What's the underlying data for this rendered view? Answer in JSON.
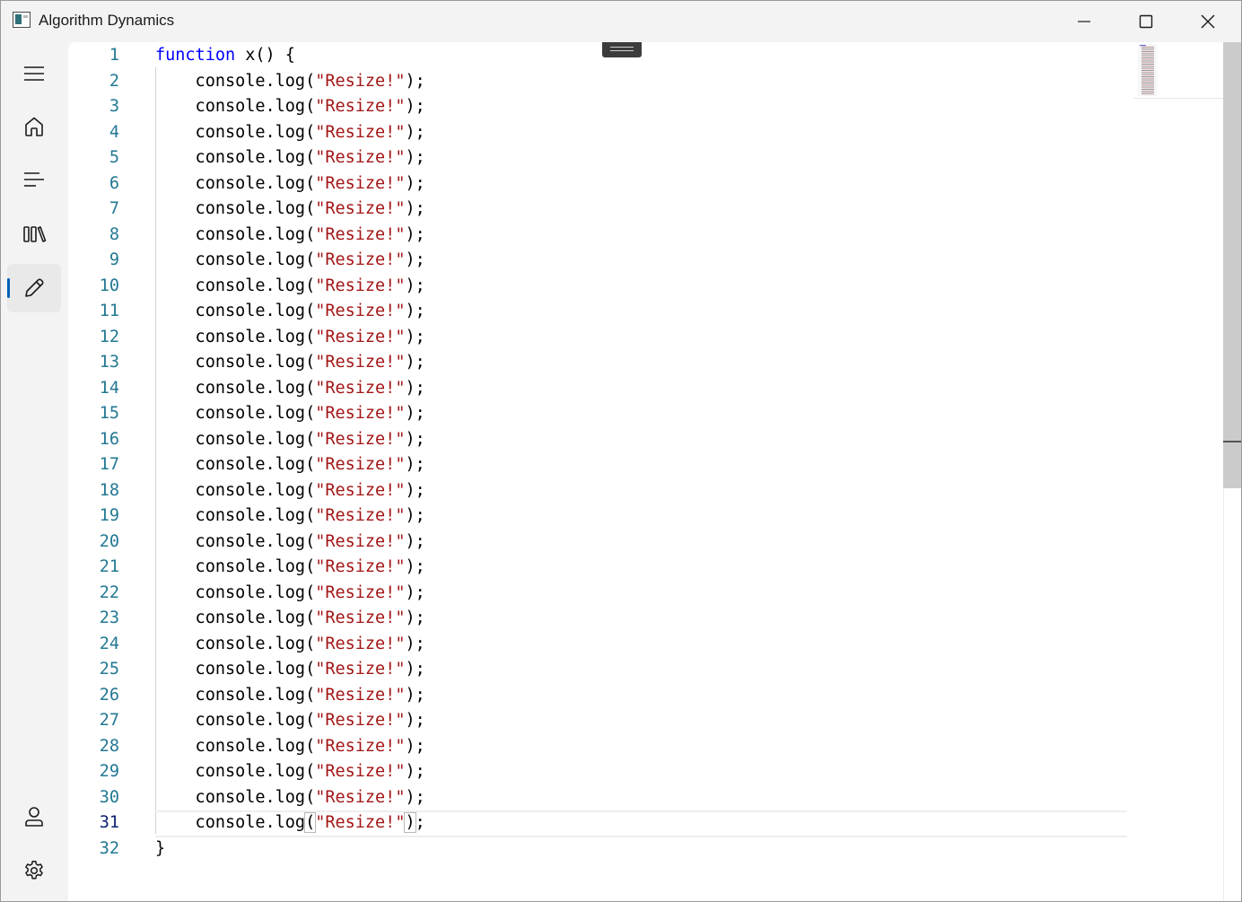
{
  "window": {
    "title": "Algorithm Dynamics"
  },
  "nav": {
    "items": [
      {
        "id": "menu",
        "icon": "hamburger-menu-icon"
      },
      {
        "id": "home",
        "icon": "home-icon"
      },
      {
        "id": "lines",
        "icon": "text-align-left-icon"
      },
      {
        "id": "library",
        "icon": "library-icon"
      },
      {
        "id": "edit",
        "icon": "pencil-icon",
        "selected": true
      },
      {
        "id": "account",
        "icon": "person-icon"
      },
      {
        "id": "settings",
        "icon": "gear-icon"
      }
    ],
    "accent": "#005fb8"
  },
  "editor": {
    "current_line": 31,
    "colors": {
      "keyword": "#0000ff",
      "string": "#a31515",
      "line_number": "#237893"
    },
    "lines": [
      {
        "n": "1",
        "pre": "",
        "kw": "function",
        "mid": " x() {",
        "str": "",
        "post": ""
      },
      {
        "n": "2",
        "pre": "    console.log(",
        "kw": "",
        "mid": "",
        "str": "\"Resize!\"",
        "post": ");"
      },
      {
        "n": "3",
        "pre": "    console.log(",
        "kw": "",
        "mid": "",
        "str": "\"Resize!\"",
        "post": ");"
      },
      {
        "n": "4",
        "pre": "    console.log(",
        "kw": "",
        "mid": "",
        "str": "\"Resize!\"",
        "post": ");"
      },
      {
        "n": "5",
        "pre": "    console.log(",
        "kw": "",
        "mid": "",
        "str": "\"Resize!\"",
        "post": ");"
      },
      {
        "n": "6",
        "pre": "    console.log(",
        "kw": "",
        "mid": "",
        "str": "\"Resize!\"",
        "post": ");"
      },
      {
        "n": "7",
        "pre": "    console.log(",
        "kw": "",
        "mid": "",
        "str": "\"Resize!\"",
        "post": ");"
      },
      {
        "n": "8",
        "pre": "    console.log(",
        "kw": "",
        "mid": "",
        "str": "\"Resize!\"",
        "post": ");"
      },
      {
        "n": "9",
        "pre": "    console.log(",
        "kw": "",
        "mid": "",
        "str": "\"Resize!\"",
        "post": ");"
      },
      {
        "n": "10",
        "pre": "    console.log(",
        "kw": "",
        "mid": "",
        "str": "\"Resize!\"",
        "post": ");"
      },
      {
        "n": "11",
        "pre": "    console.log(",
        "kw": "",
        "mid": "",
        "str": "\"Resize!\"",
        "post": ");"
      },
      {
        "n": "12",
        "pre": "    console.log(",
        "kw": "",
        "mid": "",
        "str": "\"Resize!\"",
        "post": ");"
      },
      {
        "n": "13",
        "pre": "    console.log(",
        "kw": "",
        "mid": "",
        "str": "\"Resize!\"",
        "post": ");"
      },
      {
        "n": "14",
        "pre": "    console.log(",
        "kw": "",
        "mid": "",
        "str": "\"Resize!\"",
        "post": ");"
      },
      {
        "n": "15",
        "pre": "    console.log(",
        "kw": "",
        "mid": "",
        "str": "\"Resize!\"",
        "post": ");"
      },
      {
        "n": "16",
        "pre": "    console.log(",
        "kw": "",
        "mid": "",
        "str": "\"Resize!\"",
        "post": ");"
      },
      {
        "n": "17",
        "pre": "    console.log(",
        "kw": "",
        "mid": "",
        "str": "\"Resize!\"",
        "post": ");"
      },
      {
        "n": "18",
        "pre": "    console.log(",
        "kw": "",
        "mid": "",
        "str": "\"Resize!\"",
        "post": ");"
      },
      {
        "n": "19",
        "pre": "    console.log(",
        "kw": "",
        "mid": "",
        "str": "\"Resize!\"",
        "post": ");"
      },
      {
        "n": "20",
        "pre": "    console.log(",
        "kw": "",
        "mid": "",
        "str": "\"Resize!\"",
        "post": ");"
      },
      {
        "n": "21",
        "pre": "    console.log(",
        "kw": "",
        "mid": "",
        "str": "\"Resize!\"",
        "post": ");"
      },
      {
        "n": "22",
        "pre": "    console.log(",
        "kw": "",
        "mid": "",
        "str": "\"Resize!\"",
        "post": ");"
      },
      {
        "n": "23",
        "pre": "    console.log(",
        "kw": "",
        "mid": "",
        "str": "\"Resize!\"",
        "post": ");"
      },
      {
        "n": "24",
        "pre": "    console.log(",
        "kw": "",
        "mid": "",
        "str": "\"Resize!\"",
        "post": ");"
      },
      {
        "n": "25",
        "pre": "    console.log(",
        "kw": "",
        "mid": "",
        "str": "\"Resize!\"",
        "post": ");"
      },
      {
        "n": "26",
        "pre": "    console.log(",
        "kw": "",
        "mid": "",
        "str": "\"Resize!\"",
        "post": ");"
      },
      {
        "n": "27",
        "pre": "    console.log(",
        "kw": "",
        "mid": "",
        "str": "\"Resize!\"",
        "post": ");"
      },
      {
        "n": "28",
        "pre": "    console.log(",
        "kw": "",
        "mid": "",
        "str": "\"Resize!\"",
        "post": ");"
      },
      {
        "n": "29",
        "pre": "    console.log(",
        "kw": "",
        "mid": "",
        "str": "\"Resize!\"",
        "post": ");"
      },
      {
        "n": "30",
        "pre": "    console.log(",
        "kw": "",
        "mid": "",
        "str": "\"Resize!\"",
        "post": ");"
      },
      {
        "n": "31",
        "pre": "    console.log",
        "bo": "(",
        "kw": "",
        "mid": "",
        "str": "\"Resize!\"",
        "bc": ")",
        "post": ";"
      },
      {
        "n": "32",
        "pre": "}",
        "kw": "",
        "mid": "",
        "str": "",
        "post": ""
      }
    ]
  }
}
